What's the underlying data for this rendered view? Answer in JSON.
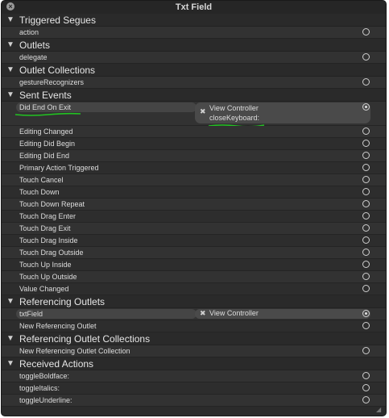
{
  "window": {
    "title": "Txt Field"
  },
  "sections": {
    "triggered_segues": {
      "title": "Triggered Segues",
      "items": [
        "action"
      ]
    },
    "outlets": {
      "title": "Outlets",
      "items": [
        "delegate"
      ]
    },
    "outlet_collections": {
      "title": "Outlet Collections",
      "items": [
        "gestureRecognizers"
      ]
    },
    "sent_events": {
      "title": "Sent Events",
      "connected": {
        "event": "Did End On Exit",
        "target": "View Controller",
        "action": "closeKeyboard:"
      },
      "items": [
        "Editing Changed",
        "Editing Did Begin",
        "Editing Did End",
        "Primary Action Triggered",
        "Touch Cancel",
        "Touch Down",
        "Touch Down Repeat",
        "Touch Drag Enter",
        "Touch Drag Exit",
        "Touch Drag Inside",
        "Touch Drag Outside",
        "Touch Up Inside",
        "Touch Up Outside",
        "Value Changed"
      ]
    },
    "referencing_outlets": {
      "title": "Referencing Outlets",
      "connected": {
        "outlet": "txtField",
        "target": "View Controller"
      },
      "items": [
        "New Referencing Outlet"
      ]
    },
    "referencing_outlet_collections": {
      "title": "Referencing Outlet Collections",
      "items": [
        "New Referencing Outlet Collection"
      ]
    },
    "received_actions": {
      "title": "Received Actions",
      "items": [
        "toggleBoldface:",
        "toggleItalics:",
        "toggleUnderline:"
      ]
    }
  },
  "colors": {
    "annotation": "#22c322"
  },
  "icons": {
    "close": "close-icon",
    "disclosure": "triangle-down-icon",
    "remove": "remove-x-icon",
    "connection": "connection-circle-icon"
  }
}
